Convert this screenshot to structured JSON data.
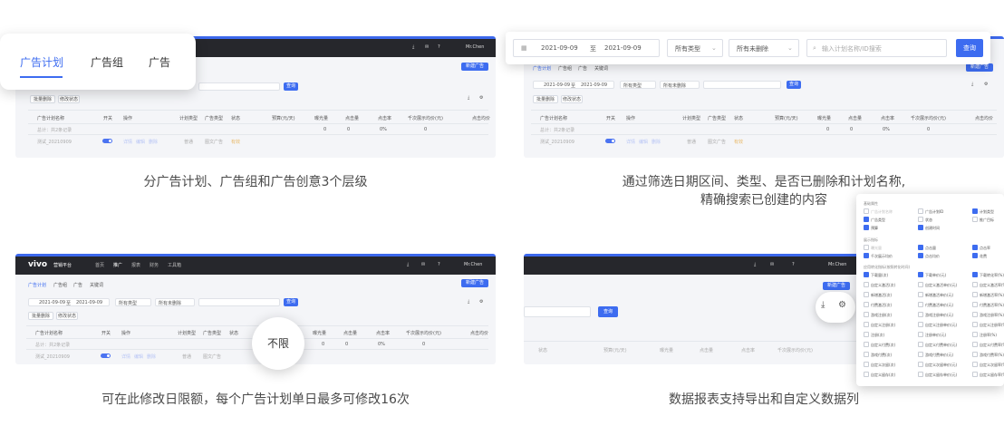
{
  "captions": {
    "c1": "分广告计划、广告组和广告创意3个层级",
    "c2_line1": "通过筛选日期区间、类型、是否已删除和计划名称,",
    "c2_line2": "精确搜索已创建的内容",
    "c3": "可在此修改日限额，每个广告计划单日最多可修改16次",
    "c4": "数据报表支持导出和自定义数据列"
  },
  "tabs_popout": {
    "tabs": [
      "广告计划",
      "广告组",
      "广告"
    ],
    "active_index": 0
  },
  "filter_popout": {
    "date_start": "2021-09-09",
    "date_sep": "至",
    "date_end": "2021-09-09",
    "type_select": "所有类型",
    "deleted_select": "所有未删除",
    "search_placeholder": "输入计划名称/ID搜索",
    "search_button": "查询"
  },
  "daily_limit_bubble": "不限",
  "app": {
    "logo": "vivo",
    "platform": "营销平台",
    "nav": [
      "首页",
      "推广",
      "报表",
      "财务",
      "工具箱"
    ],
    "account": "Mr.Chen",
    "new_button": "新建广告",
    "tabs_small": [
      "广告计划",
      "广告组",
      "广告",
      "关键词"
    ],
    "bulk_actions": [
      "批量删除",
      "修改状态"
    ],
    "columns": [
      "广告计划名称",
      "开关",
      "操作",
      "计划类型",
      "广告类型",
      "状态",
      "预算(元/天)",
      "曝光量",
      "点击量",
      "点击率",
      "千次展示均价(元)",
      "点击均价"
    ],
    "total_row": "总计：共2条记录",
    "row_name": "测试_20210909",
    "row_actions": [
      "详情",
      "编辑",
      "删除"
    ],
    "row_type": "普通",
    "row_adtype": "图文广告",
    "row_status": "有效",
    "row_budget": "不限",
    "zeros": "0",
    "percent": "0%",
    "dash": "-"
  },
  "columns_popout": {
    "section_basic": "基础属性",
    "basic": [
      {
        "label": "广告计划名称",
        "state": "dis"
      },
      {
        "label": "广告计划ID",
        "state": "off"
      },
      {
        "label": "计划类型",
        "state": "on"
      },
      {
        "label": "广告类型",
        "state": "on"
      },
      {
        "label": "状态",
        "state": "off"
      },
      {
        "label": "推广目标",
        "state": "off"
      },
      {
        "label": "预算",
        "state": "on"
      },
      {
        "label": "创建时间",
        "state": "on"
      }
    ],
    "section_show": "展示指标",
    "show": [
      {
        "label": "曝光量",
        "state": "dis"
      },
      {
        "label": "点击量",
        "state": "on"
      },
      {
        "label": "点击率",
        "state": "on"
      },
      {
        "label": "千次展示均价",
        "state": "on"
      },
      {
        "label": "点击均价",
        "state": "on"
      },
      {
        "label": "花费",
        "state": "on"
      }
    ],
    "section_convert": "应用转化指标(按照转化时间)",
    "convert": [
      {
        "label": "下载量(次)",
        "state": "on"
      },
      {
        "label": "下载单价(元)",
        "state": "on"
      },
      {
        "label": "下载转化率(%)",
        "state": "on"
      },
      {
        "label": "自定义激活(次)",
        "state": "off"
      },
      {
        "label": "自定义激活单价(元)",
        "state": "off"
      },
      {
        "label": "自定义激活率(%)",
        "state": "off"
      },
      {
        "label": "新增激活(次)",
        "state": "off"
      },
      {
        "label": "新增激活单价(元)",
        "state": "off"
      },
      {
        "label": "新增激活率(%)",
        "state": "off"
      },
      {
        "label": "付费激活(次)",
        "state": "off"
      },
      {
        "label": "付费激活单价(元)",
        "state": "off"
      },
      {
        "label": "付费激活率(%)",
        "state": "off"
      },
      {
        "label": "游戏注册(次)",
        "state": "off"
      },
      {
        "label": "游戏注册单价(元)",
        "state": "off"
      },
      {
        "label": "游戏注册率(%)",
        "state": "off"
      },
      {
        "label": "自定义注册(次)",
        "state": "off"
      },
      {
        "label": "自定义注册单价(元)",
        "state": "off"
      },
      {
        "label": "自定义注册率(%)",
        "state": "off"
      },
      {
        "label": "注册(次)",
        "state": "off"
      },
      {
        "label": "注册单价(元)",
        "state": "off"
      },
      {
        "label": "注册率(%)",
        "state": "off"
      },
      {
        "label": "自定义付费(次)",
        "state": "off"
      },
      {
        "label": "自定义付费单价(元)",
        "state": "off"
      },
      {
        "label": "自定义付费率(%)",
        "state": "off"
      },
      {
        "label": "游戏付费(次)",
        "state": "off"
      },
      {
        "label": "游戏付费单价(元)",
        "state": "off"
      },
      {
        "label": "游戏付费率(%)",
        "state": "off"
      },
      {
        "label": "自定义次留(次)",
        "state": "off"
      },
      {
        "label": "自定义次留单价(元)",
        "state": "off"
      },
      {
        "label": "自定义次留率(%)",
        "state": "off"
      },
      {
        "label": "自定义留存(次)",
        "state": "off"
      },
      {
        "label": "自定义留存单价(元)",
        "state": "off"
      },
      {
        "label": "自定义留存率(%)",
        "state": "off"
      }
    ]
  },
  "colors": {
    "accent": "#3d6cf0",
    "dark_bar": "#26272c"
  }
}
